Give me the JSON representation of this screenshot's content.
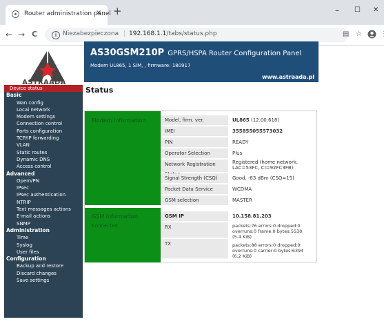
{
  "browser": {
    "tab_title": "Router administration panel",
    "tab_close": "×",
    "new_tab": "+",
    "insecure_label": "Niezabezpieczona",
    "url_separator": "|",
    "url_host": "192.168.1.1",
    "url_path": "/tabs/status.php",
    "controls": {
      "minimize": "–",
      "maximize": "☐",
      "close": "✕"
    },
    "nav": {
      "back": "←",
      "forward": "→",
      "reload": "C"
    }
  },
  "logo": {
    "brand": "ASTRAADA",
    "colors": {
      "dark": "#454545",
      "accent": "#d7262d"
    }
  },
  "banner": {
    "model": "AS30GSM210P",
    "subtitle": "GPRS/HSPA Router Configuration Panel",
    "modem_line": "Modem UL865, 1 SIM, , firmware: 180917",
    "website": "www.astraada.pl",
    "background": "#1f4e79"
  },
  "sidebar": {
    "active": "Device status",
    "sections": [
      {
        "title": "Basic",
        "items": [
          "Wan config",
          "Local network",
          "Modem settings",
          "Connection control",
          "Ports configuration",
          "TCP/IP forwarding",
          "VLAN",
          "Static routes",
          "Dynamic DNS",
          "Access control"
        ]
      },
      {
        "title": "Advanced",
        "items": [
          "OpenVPN",
          "IPsec",
          "IPsec authentication",
          "NTRIP",
          "Text messages actions",
          "E-mail actions",
          "SNMP"
        ]
      },
      {
        "title": "Administration",
        "items": [
          "Time",
          "Syslog",
          "User files"
        ]
      },
      {
        "title": "Configuration",
        "items": [
          "Backup and restore",
          "Discard changes",
          "Save settings"
        ]
      }
    ]
  },
  "page_title": "Status",
  "modem": {
    "section_title": "Modem information",
    "rows": [
      {
        "label": "Model, firm. ver.",
        "value_bold": "UL865",
        "value": " (12.00.618)"
      },
      {
        "label": "IMEI",
        "value_bold": "355855055573032",
        "value": ""
      },
      {
        "label": "PIN",
        "value_bold": "",
        "value": "READY"
      },
      {
        "label": "Operator Selection",
        "value_bold": "",
        "value": "Plus"
      },
      {
        "label": "Network Registration Status",
        "value_bold": "",
        "value": "Registered (home network, LAC=53FC, CI=92FC3FB)"
      },
      {
        "label": "Signal Strength (CSQ)",
        "value_bold": "",
        "value": "Good, -83 dBm (CSQ=15)"
      },
      {
        "label": "Packet Data Service",
        "value_bold": "",
        "value": "WCDMA"
      },
      {
        "label": "GSM selection",
        "value_bold": "",
        "value": "MASTER"
      }
    ]
  },
  "gsm": {
    "section_title": "GSM information",
    "status": "Connected",
    "ip_label": "GSM IP",
    "ip": "10.158.81.203",
    "rx_label": "RX",
    "rx": "packets:76 errors:0 dropped:0 overruns:0 frame:0 bytes:5530 (5.4 KiB)",
    "tx_label": "TX",
    "tx": "packets:88 errors:0 dropped:0 overruns:0 carrier:0 bytes:6394 (6.2 KiB)"
  }
}
